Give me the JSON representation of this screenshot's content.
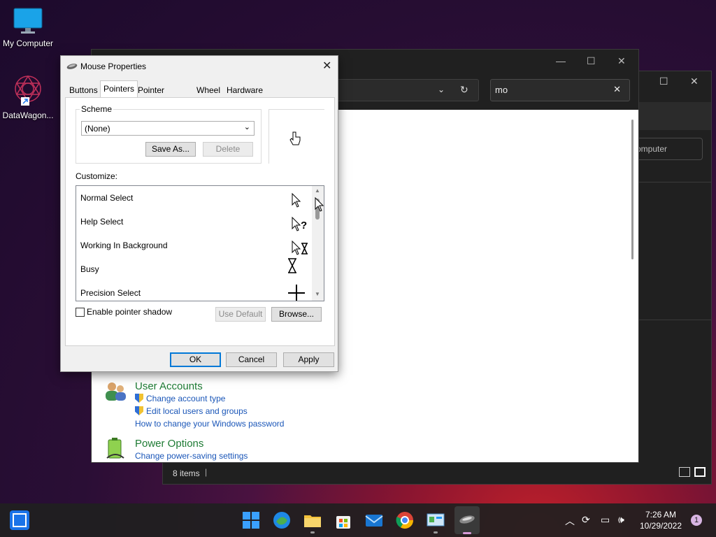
{
  "desktop": {
    "icons": [
      {
        "label": "My Computer",
        "icon": "monitor-icon"
      },
      {
        "label": "DataWagon...",
        "icon": "datawagon-icon"
      }
    ]
  },
  "back_window": {
    "button_label": "omputer",
    "status_text": "8 items"
  },
  "control_panel": {
    "search_value": "mo",
    "sections": [
      {
        "heading": "User Accounts",
        "links": [
          {
            "text": "Change account type",
            "shield": true
          },
          {
            "text": "Edit local users and groups",
            "shield": true
          },
          {
            "text": "How to change your Windows password",
            "shield": false
          }
        ]
      },
      {
        "heading": "Power Options",
        "links": [
          {
            "text": "Change power-saving settings",
            "shield": false
          }
        ]
      }
    ]
  },
  "dialog": {
    "title": "Mouse Properties",
    "tabs": [
      "Buttons",
      "Pointers",
      "Pointer Options",
      "Wheel",
      "Hardware"
    ],
    "active_tab": "Pointers",
    "scheme_label": "Scheme",
    "scheme_value": "(None)",
    "save_as_label": "Save As...",
    "delete_label": "Delete",
    "customize_label": "Customize:",
    "pointers": [
      {
        "name": "Normal Select",
        "icon": "arrow-cursor-icon"
      },
      {
        "name": "Help Select",
        "icon": "help-cursor-icon"
      },
      {
        "name": "Working In Background",
        "icon": "working-cursor-icon"
      },
      {
        "name": "Busy",
        "icon": "hourglass-cursor-icon"
      },
      {
        "name": "Precision Select",
        "icon": "crosshair-cursor-icon"
      }
    ],
    "shadow_label": "Enable pointer shadow",
    "use_default_label": "Use Default",
    "browse_label": "Browse...",
    "ok_label": "OK",
    "cancel_label": "Cancel",
    "apply_label": "Apply"
  },
  "taskbar": {
    "time": "7:26 AM",
    "date": "10/29/2022",
    "notification_count": "1"
  },
  "colors": {
    "accent": "#0078d7",
    "link": "#1a56b8",
    "heading_green": "#1e7b34"
  }
}
